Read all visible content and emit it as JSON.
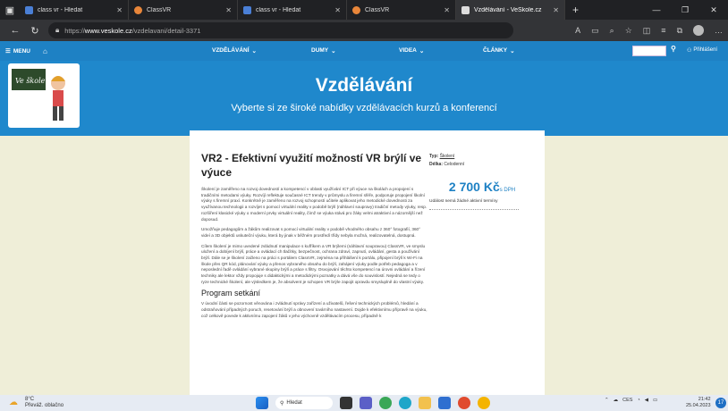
{
  "browser": {
    "tabs": [
      {
        "title": "class vr - Hledat",
        "favicon_color": "#4a7fd6",
        "active": false
      },
      {
        "title": "ClassVR",
        "favicon_color": "#e8863a",
        "active": false
      },
      {
        "title": "class vr - Hledat",
        "favicon_color": "#4a7fd6",
        "active": false
      },
      {
        "title": "ClassVR",
        "favicon_color": "#e8863a",
        "active": false
      },
      {
        "title": "Vzdělávání - VeŠkole.cz",
        "favicon_color": "#dddddd",
        "active": true
      }
    ],
    "url_prefix": "https://",
    "url_host": "www.veskole.cz",
    "url_path": "/vzdelavani/detail-3371"
  },
  "site_nav": {
    "menu_label": "MENU",
    "items": [
      "VZDĚLÁVÁNÍ",
      "DUMY",
      "VIDEA",
      "ČLÁNKY"
    ],
    "login_label": "Přihlášení"
  },
  "hero": {
    "title": "Vzdělávání",
    "subtitle": "Vyberte si ze široké nabídky vzdělávacích kurzů a konferencí",
    "logo_text": "Ve škole.cz"
  },
  "course": {
    "title": "VR2 - Efektivní využití možností VR brýlí ve výuce",
    "paragraphs": [
      "Školení je zaměřeno na rozvoj dovedností a kompetencí v oblasti využívání ICT při výuce na školách a propojení s tradičními metodami výuky. Rozvíjí reflektuje současné ICT trendy v průmyslu a firemní sféře, podporuje propojení školní výuky s firemní praxí. Konkrétně je zaměřeno na rozvoj schopností učitele aplikovat jeho metodické dovednosti za využívanou technologii a rozvíjet s pomocí virtuální reality v podobě brýlí (náhlavní soupravy) tradiční metody výuky, resp. rozšíření klasické výuky o moderní prvky virtuální reality, čímž se výuka stává pro žáky velmi atraktivní a názornější než doposud.",
      "Umožňuje pedagogům a žákům realizovat s pomocí virtuální reality v podobě vhodného obsahu z 360° fotografií, 360° videí a 3D objektů uskuteční výuku, která by jinak v běžném prostředí třídy nebyla možná, realizovatelná, dostupná.",
      "Cílem školení je mimo uvedené zvládnutí manipulace s kufříkem a VR brýlemi (náhlavní soupravou) ClassVR, ve smyslu uložení a dobíjení brýlí, práce a ovládací ch tlačítky, bezpečnost, ochrana zdraví, zapnutí, ovládání, gesta a používání brýlí. Dále se je školení začleno na práci s portálem ClassVR, zejména na přihlášení k portálu, připojení brýlí k Wi-Fi na škole přes QR kód, plánování výuky a přenos vybraného obsahu do brýlí, zahájení výuky podle potřeb pedagoga a v neposlední řadě ovládání vybrané skupiny brýlí a práce s filtry. Osvojování těchto kompetencí na úrovni ovládání a řízení techniky ale lektor vždy propojuje s didaktickými a metodickými poznatky a dává vše do souvislostí. Nejedná se tedy o ryze technické školení, ale výsledkem je, že absolvent je schopen VR brýle zapojit opravdu smysluplně do vlastní výuky."
    ],
    "section_heading": "Program setkání",
    "section_paragraph": "V úvodní části se pozornost věnována i zvládnutí správy zařízení a uživatelů, řešení technických problémů, hledání a odstraňování případných poruch, resetování brýlí a obnovení továrního nastavení. Dojde k efektivnímu přípravě na výuku, což celkově povede k aktivnímu zapojení žáků v jeho výchovně vzdělávacím procesu, případně k",
    "type_label": "Typ:",
    "type_value": "Školení",
    "duration_label": "Délka:",
    "duration_value": "Celodenní",
    "price": "2 700 Kč",
    "price_suffix": "s DPH",
    "events_note": "Událost nemá žádné aktivní termíny"
  },
  "taskbar": {
    "weather_temp": "8°C",
    "weather_desc": "Převáž. oblačno",
    "search_label": "Hledat",
    "lang": "CES",
    "time": "21:42",
    "date": "25.04.2023",
    "notification_count": "17"
  }
}
